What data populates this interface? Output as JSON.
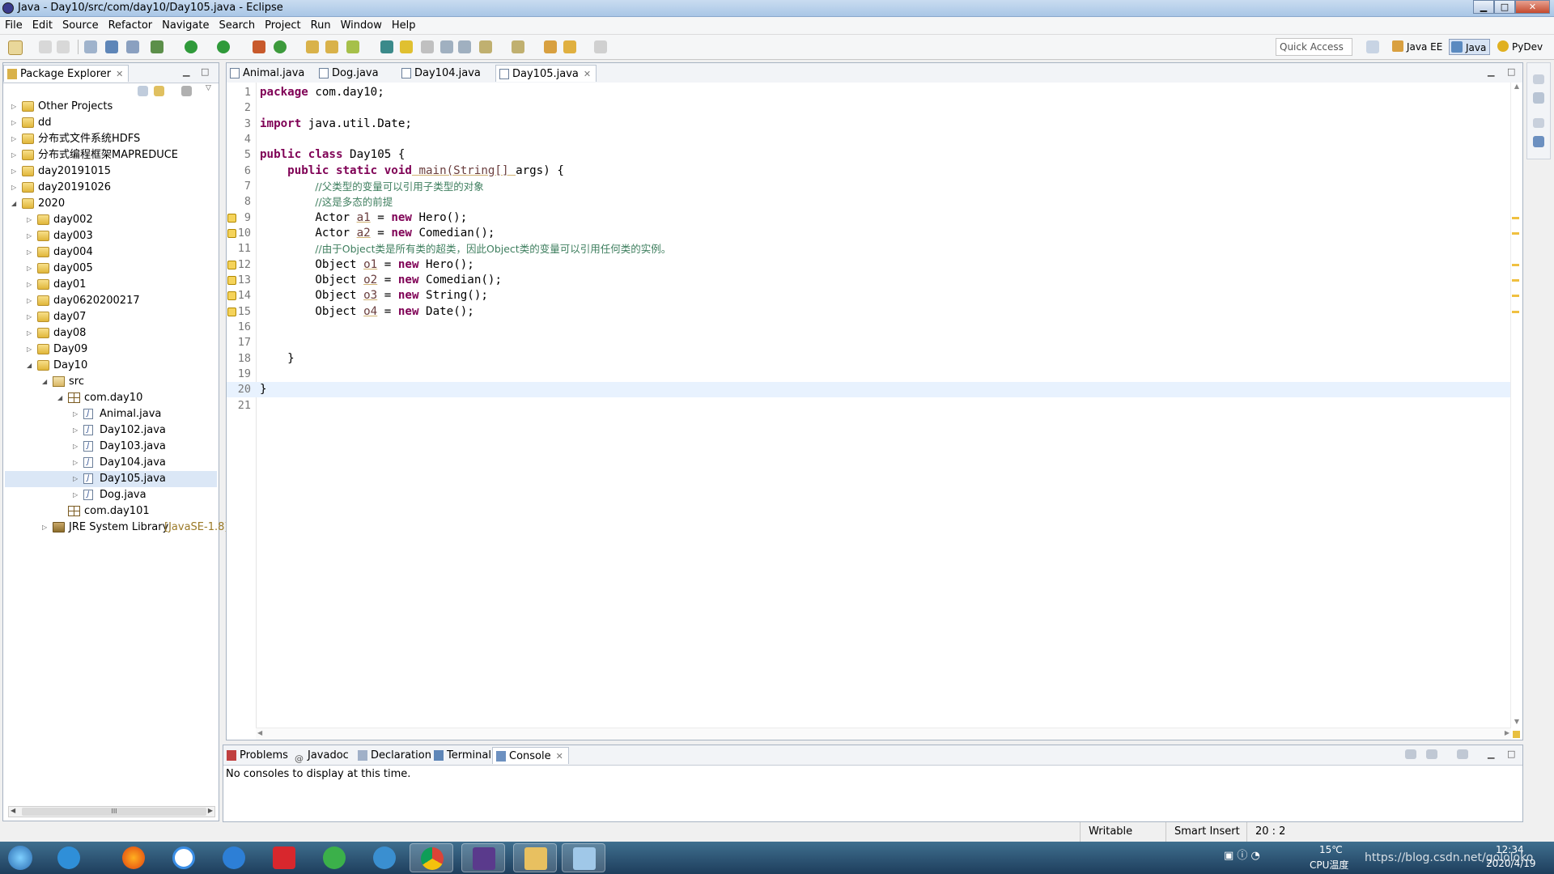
{
  "window": {
    "title": "Java - Day10/src/com/day10/Day105.java - Eclipse",
    "min": "▁",
    "max": "□",
    "close": "✕"
  },
  "menu": [
    "File",
    "Edit",
    "Source",
    "Refactor",
    "Navigate",
    "Search",
    "Project",
    "Run",
    "Window",
    "Help"
  ],
  "toolbar": {
    "quick_access_placeholder": "Quick Access",
    "perspectives": [
      "Java EE",
      "Java",
      "PyDev"
    ]
  },
  "package_explorer": {
    "tab": "Package Explorer",
    "rows": [
      "Other Projects",
      "dd",
      "分布式文件系统HDFS",
      "分布式编程框架MAPREDUCE",
      "day20191015",
      "day20191026",
      "2020",
      "day002",
      "day003",
      "day004",
      "day005",
      "day01",
      "day0620200217",
      "day07",
      "day08",
      "Day09",
      "Day10",
      "src",
      "com.day10",
      "Animal.java",
      "Day102.java",
      "Day103.java",
      "Day104.java",
      "Day105.java",
      "Dog.java",
      "com.day101",
      "JRE System Library"
    ],
    "jre_version": "[JavaSE-1.8]",
    "scroll_thumb": "III"
  },
  "editor": {
    "tabs": [
      "Animal.java",
      "Dog.java",
      "Day104.java",
      "Day105.java"
    ],
    "active_tab": "Day105.java",
    "line_numbers": [
      "1",
      "2",
      "3",
      "4",
      "5",
      "6",
      "7",
      "8",
      "9",
      "10",
      "11",
      "12",
      "13",
      "14",
      "15",
      "16",
      "17",
      "18",
      "19",
      "20",
      "21"
    ],
    "code": {
      "l1": [
        "package",
        " com.day10;"
      ],
      "l3": [
        "import",
        " java.util.Date;"
      ],
      "l5": [
        "public",
        " ",
        "class",
        " Day105 {"
      ],
      "l6": [
        "public",
        " ",
        "static",
        " ",
        "void",
        " main(String[] ",
        "args",
        ") {"
      ],
      "l7": "//父类型的变量可以引用子类型的对象",
      "l8": "//这是多态的前提",
      "l9": [
        "Actor ",
        "a1",
        " = ",
        "new",
        " Hero();"
      ],
      "l10": [
        "Actor ",
        "a2",
        " = ",
        "new",
        " Comedian();"
      ],
      "l11": "//由于Object类是所有类的超类，因此Object类的变量可以引用任何类的实例。",
      "l12": [
        "Object ",
        "o1",
        " = ",
        "new",
        " Hero();"
      ],
      "l13": [
        "Object ",
        "o2",
        " = ",
        "new",
        " Comedian();"
      ],
      "l14": [
        "Object ",
        "o3",
        " = ",
        "new",
        " String();"
      ],
      "l15": [
        "Object ",
        "o4",
        " = ",
        "new",
        " Date();"
      ],
      "l18": "}",
      "l20": "}"
    }
  },
  "console": {
    "tabs": [
      "Problems",
      "Javadoc",
      "Declaration",
      "Terminal",
      "Console"
    ],
    "message": "No consoles to display at this time."
  },
  "status": {
    "writable": "Writable",
    "insert": "Smart Insert",
    "position": "20 : 2"
  },
  "taskbar": {
    "temperature": "15℃",
    "cpu_label": "CPU温度",
    "time": "12:34",
    "date": "2020/4/19",
    "watermark": "https://blog.csdn.net/gololoko"
  }
}
